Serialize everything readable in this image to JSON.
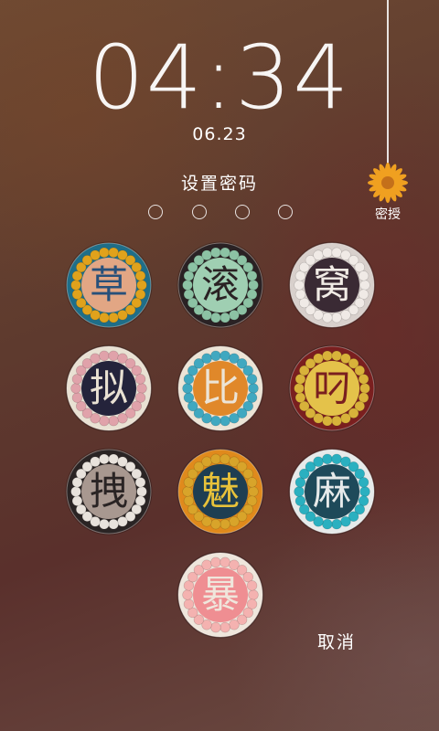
{
  "lockscreen": {
    "time": "04:34",
    "date": "06.23",
    "prompt": "设置密码",
    "hint_label": "密授",
    "cancel_label": "取消",
    "entered_digits": 0,
    "total_digits": 4
  },
  "keys": [
    {
      "char": "草",
      "outer": "#1f6e88",
      "beads": "#e0a21c",
      "inner": "#e2a684",
      "text": "#27507a"
    },
    {
      "char": "滚",
      "outer": "#2a2224",
      "beads": "#8cc2a4",
      "inner": "#9fcfb2",
      "text": "#2a2224"
    },
    {
      "char": "窝",
      "outer": "#d8d0cc",
      "beads": "#f0eae6",
      "inner": "#3a2a34",
      "text": "#f2ece6"
    },
    {
      "char": "拟",
      "outer": "#e9e1d3",
      "beads": "#e0a2aa",
      "inner": "#24233b",
      "text": "#e9e1d3"
    },
    {
      "char": "比",
      "outer": "#ece4d6",
      "beads": "#40a8c0",
      "inner": "#e0882a",
      "text": "#ece4d6"
    },
    {
      "char": "叼",
      "outer": "#7a1f1f",
      "beads": "#d8b23a",
      "inner": "#e4c24a",
      "text": "#7a1f1f"
    },
    {
      "char": "拽",
      "outer": "#2a2424",
      "beads": "#e8e2dc",
      "inner": "#a89890",
      "text": "#2a2424"
    },
    {
      "char": "魅",
      "outer": "#e08a1c",
      "beads": "#d8a42a",
      "inner": "#1e3e52",
      "text": "#e8c23a"
    },
    {
      "char": "麻",
      "outer": "#e6eaea",
      "beads": "#2ab0c0",
      "inner": "#1e4a5a",
      "text": "#e6eaea"
    },
    {
      "char": "暴",
      "outer": "#efe6dc",
      "beads": "#f4b2b0",
      "inner": "#ef8e92",
      "text": "#efe6dc"
    }
  ],
  "icons": {
    "hint": "daisy-flower-icon"
  },
  "colors": {
    "text": "#ffffff",
    "flower_petal": "#f0a020",
    "flower_center": "#c4701a"
  }
}
